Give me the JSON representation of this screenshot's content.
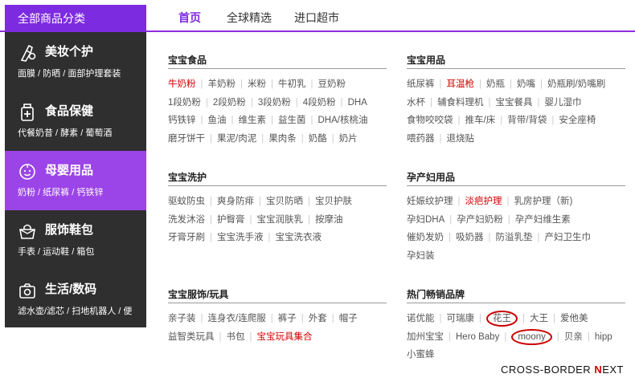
{
  "header": {
    "category_title": "全部商品分类",
    "tabs": [
      {
        "label": "首页",
        "active": true
      },
      {
        "label": "全球精选",
        "active": false
      },
      {
        "label": "进口超市",
        "active": false
      }
    ],
    "accent": "#7d2be0"
  },
  "sidebar": {
    "items": [
      {
        "title": "美妆个护",
        "sub": "面膜 / 防晒 / 面部护理套装",
        "icon": "lipstick-icon",
        "active": false
      },
      {
        "title": "食品保健",
        "sub": "代餐奶昔 / 酵素 / 葡萄酒",
        "icon": "supplement-icon",
        "active": false
      },
      {
        "title": "母婴用品",
        "sub": "奶粉 / 纸尿裤 / 钙铁锌",
        "icon": "baby-icon",
        "active": true
      },
      {
        "title": "服饰鞋包",
        "sub": "手表 / 运动鞋 / 箱包",
        "icon": "bag-icon",
        "active": false
      },
      {
        "title": "生活/数码",
        "sub": "滤水壶/滤芯 / 扫地机器人 / 便",
        "icon": "camera-icon",
        "active": false
      }
    ]
  },
  "sections": [
    {
      "title": "宝宝食品",
      "lines": [
        [
          {
            "t": "牛奶粉",
            "red": true
          },
          {
            "t": "羊奶粉"
          },
          {
            "t": "米粉"
          },
          {
            "t": "牛初乳"
          },
          {
            "t": "豆奶粉"
          }
        ],
        [
          {
            "t": "1段奶粉"
          },
          {
            "t": "2段奶粉"
          },
          {
            "t": "3段奶粉"
          },
          {
            "t": "4段奶粉"
          },
          {
            "t": "DHA"
          }
        ],
        [
          {
            "t": "钙铁锌"
          },
          {
            "t": "鱼油"
          },
          {
            "t": "维生素"
          },
          {
            "t": "益生菌"
          },
          {
            "t": "DHA/核桃油"
          }
        ],
        [
          {
            "t": "磨牙饼干"
          },
          {
            "t": "果泥/肉泥"
          },
          {
            "t": "果肉条"
          },
          {
            "t": "奶酪"
          },
          {
            "t": "奶片"
          }
        ]
      ]
    },
    {
      "title": "宝宝用品",
      "lines": [
        [
          {
            "t": "纸尿裤"
          },
          {
            "t": "耳温枪",
            "red": true
          },
          {
            "t": "奶瓶"
          },
          {
            "t": "奶嘴"
          },
          {
            "t": "奶瓶刷/奶嘴刷"
          }
        ],
        [
          {
            "t": "水杯"
          },
          {
            "t": "辅食料理机"
          },
          {
            "t": "宝宝餐具"
          },
          {
            "t": "婴儿湿巾"
          }
        ],
        [
          {
            "t": "食物咬咬袋"
          },
          {
            "t": "推车/床"
          },
          {
            "t": "背带/背袋"
          },
          {
            "t": "安全座椅"
          }
        ],
        [
          {
            "t": "喂药器"
          },
          {
            "t": "退烧贴"
          }
        ]
      ]
    },
    {
      "title": "宝宝洗护",
      "lines": [
        [
          {
            "t": "驱蚊防虫"
          },
          {
            "t": "爽身防痱"
          },
          {
            "t": "宝贝防晒"
          },
          {
            "t": "宝贝护肤"
          }
        ],
        [
          {
            "t": "洗发沐浴"
          },
          {
            "t": "护臀膏"
          },
          {
            "t": "宝宝润肤乳"
          },
          {
            "t": "按摩油"
          }
        ],
        [
          {
            "t": "牙膏牙刷"
          },
          {
            "t": "宝宝洗手液"
          },
          {
            "t": "宝宝洗衣液"
          }
        ]
      ]
    },
    {
      "title": "孕产妇用品",
      "lines": [
        [
          {
            "t": "妊娠纹护理"
          },
          {
            "t": "淡疤护理",
            "red": true
          },
          {
            "t": "乳房护理（新)"
          }
        ],
        [
          {
            "t": "孕妇DHA"
          },
          {
            "t": "孕产妇奶粉"
          },
          {
            "t": "孕产妇维生素"
          }
        ],
        [
          {
            "t": "催奶发奶"
          },
          {
            "t": "吸奶器"
          },
          {
            "t": "防溢乳垫"
          },
          {
            "t": "产妇卫生巾"
          }
        ],
        [
          {
            "t": "孕妇装"
          }
        ]
      ]
    },
    {
      "title": "宝宝服饰/玩具",
      "lines": [
        [
          {
            "t": "亲子装"
          },
          {
            "t": "连身衣/连爬服"
          },
          {
            "t": "裤子"
          },
          {
            "t": "外套"
          },
          {
            "t": "帽子"
          }
        ],
        [
          {
            "t": "益智类玩具"
          },
          {
            "t": "书包"
          },
          {
            "t": "宝宝玩具集合",
            "red": true
          }
        ]
      ]
    },
    {
      "title": "热门畅销品牌",
      "lines": [
        [
          {
            "t": "诺优能"
          },
          {
            "t": "可瑞康"
          },
          {
            "t": "花王",
            "circled": true
          },
          {
            "t": "大王"
          },
          {
            "t": "爱他美"
          }
        ],
        [
          {
            "t": "加州宝宝"
          },
          {
            "t": "Hero Baby"
          },
          {
            "t": "moony",
            "circled": true
          },
          {
            "t": "贝亲"
          },
          {
            "t": "hipp"
          }
        ],
        [
          {
            "t": "小蜜蜂"
          }
        ]
      ]
    }
  ],
  "watermark": {
    "a": "CROSS-BORDER ",
    "x": "N",
    "b": "EXT"
  }
}
